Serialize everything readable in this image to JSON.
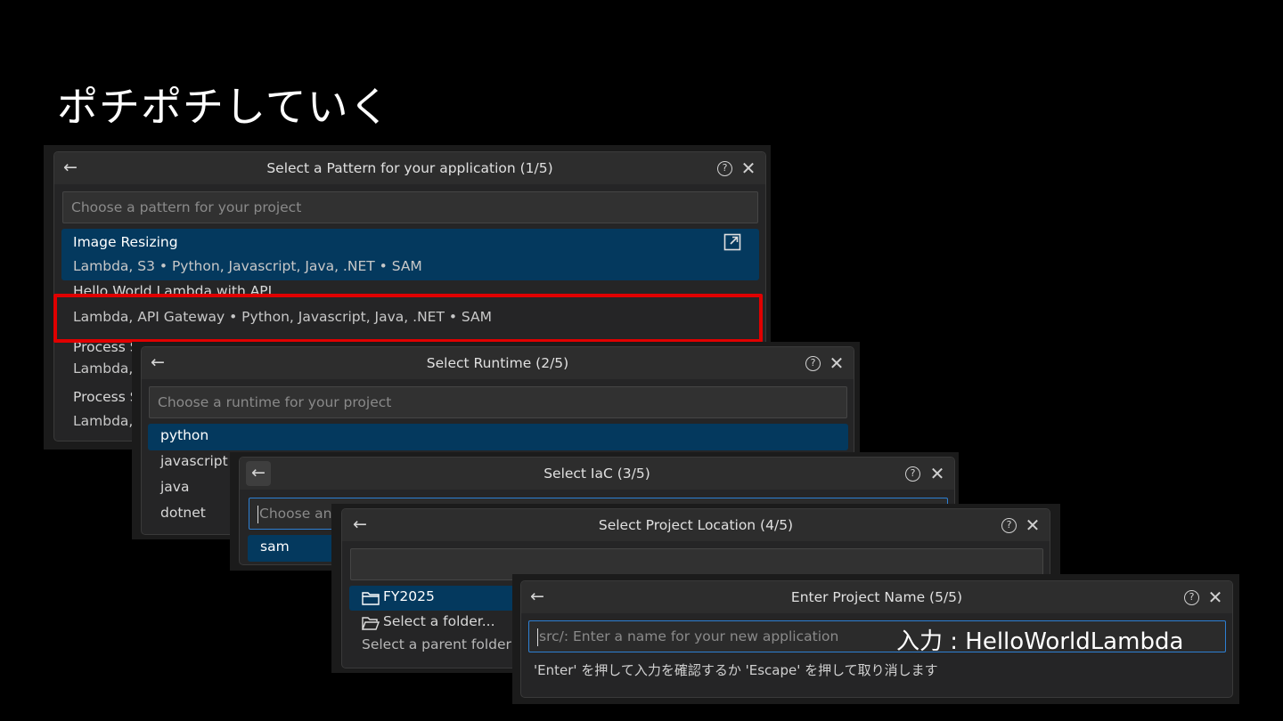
{
  "slide": {
    "title": "ポチポチしていく"
  },
  "panels": {
    "pattern": {
      "title": "Select a Pattern for your application (1/5)",
      "placeholder": "Choose a pattern for your project",
      "items": [
        {
          "name": "Image Resizing",
          "detail": "Lambda, S3 • Python, Javascript, Java, .NET • SAM"
        },
        {
          "name": "Hello World Lambda with API",
          "detail": "Lambda, API Gateway • Python, Javascript, Java, .NET • SAM"
        },
        {
          "name": "Process S",
          "detail": "Lambda,"
        },
        {
          "name": "Process S",
          "detail": "Lambda,"
        }
      ]
    },
    "runtime": {
      "title": "Select Runtime (2/5)",
      "placeholder": "Choose a runtime for your project",
      "items": [
        "python",
        "javascript",
        "java",
        "dotnet"
      ]
    },
    "iac": {
      "title": "Select IaC (3/5)",
      "placeholder": "Choose an",
      "items": [
        "sam"
      ]
    },
    "location": {
      "title": "Select Project Location (4/5)",
      "placeholder": "",
      "items": [
        {
          "label": "FY2025",
          "icon": "folder-icon"
        },
        {
          "label": "Select a folder...",
          "icon": "folder-open-icon"
        }
      ],
      "detail": "Select a parent folder f"
    },
    "name": {
      "title": "Enter Project Name (5/5)",
      "placeholder": "src/: Enter a name for your new application",
      "hint": "'Enter' を押して入力を確認するか 'Escape' を押して取り消します"
    }
  },
  "annotation": {
    "input_label": "入力 : HelloWorldLambda",
    "highlight_color": "#e00000"
  },
  "colors": {
    "selected": "#04395e",
    "focus_border": "#2d7fd3",
    "panel_bg": "#252526"
  }
}
